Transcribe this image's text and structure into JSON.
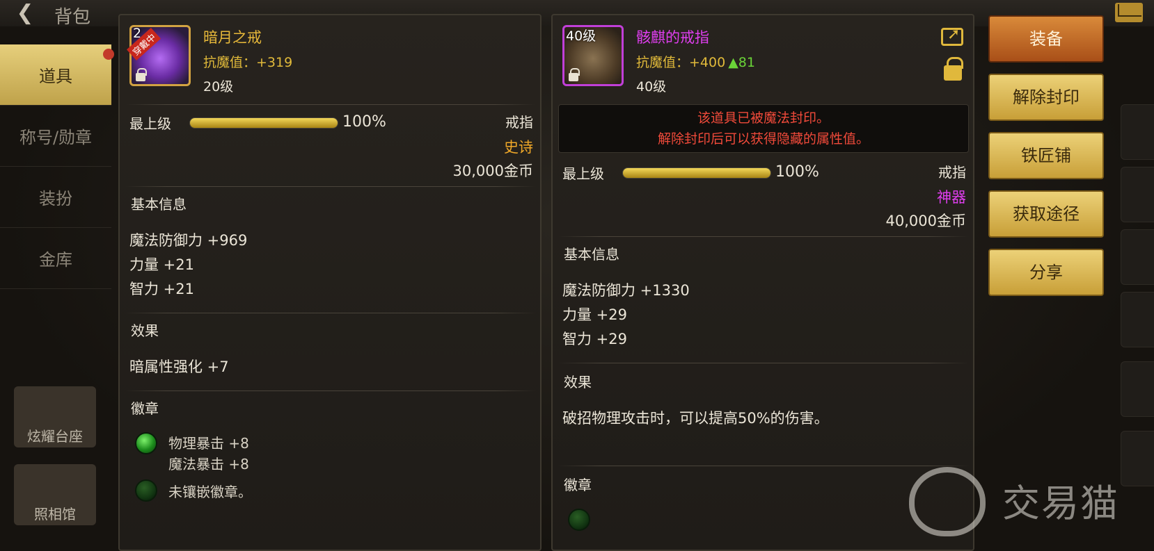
{
  "topbar": {
    "title": "背包"
  },
  "nav": {
    "items": [
      "道具",
      "称号/勋章",
      "装扮",
      "金库"
    ],
    "active_index": 0,
    "cards": [
      "炫耀台座",
      "照相馆"
    ]
  },
  "left_item": {
    "icon_level": "2",
    "equipped_tag": "穿戴中",
    "name": "暗月之戒",
    "name_color": "#e8b93a",
    "stat_text": "抗魔值：+319",
    "level": "20级",
    "tier_label": "最上级",
    "progress_pct": 100,
    "progress_text": "100%",
    "slot": "戒指",
    "rarity": "史诗",
    "rarity_color": "#f0a828",
    "price": "30,000金币",
    "basic_title": "基本信息",
    "basic_stats": [
      "魔法防御力 +969",
      "力量 +21",
      "智力 +21"
    ],
    "effect_title": "效果",
    "effects": [
      "暗属性强化 +7"
    ],
    "emblem_title": "徽章",
    "emblems": [
      {
        "filled": true,
        "lines": [
          "物理暴击 +8",
          "魔法暴击 +8"
        ]
      },
      {
        "filled": false,
        "lines": [
          "未镶嵌徽章。"
        ]
      }
    ]
  },
  "right_item": {
    "icon_level": "40级",
    "name": "骸麒的戒指",
    "name_color": "#e03ef0",
    "stat_text": "抗魔值：+400",
    "stat_diff": "▲81",
    "level": "40级",
    "seal_lines": [
      "该道具已被魔法封印。",
      "解除封印后可以获得隐藏的属性值。"
    ],
    "tier_label": "最上级",
    "progress_pct": 100,
    "progress_text": "100%",
    "slot": "戒指",
    "rarity": "神器",
    "rarity_color": "#e03ef0",
    "price": "40,000金币",
    "basic_title": "基本信息",
    "basic_stats": [
      "魔法防御力 +1330",
      "力量 +29",
      "智力 +29"
    ],
    "effect_title": "效果",
    "effects": [
      "破招物理攻击时，可以提高50%的伤害。"
    ],
    "emblem_title": "徽章"
  },
  "actions": [
    "装备",
    "解除封印",
    "铁匠铺",
    "获取途径",
    "分享"
  ],
  "watermark": {
    "text": "交易猫"
  }
}
